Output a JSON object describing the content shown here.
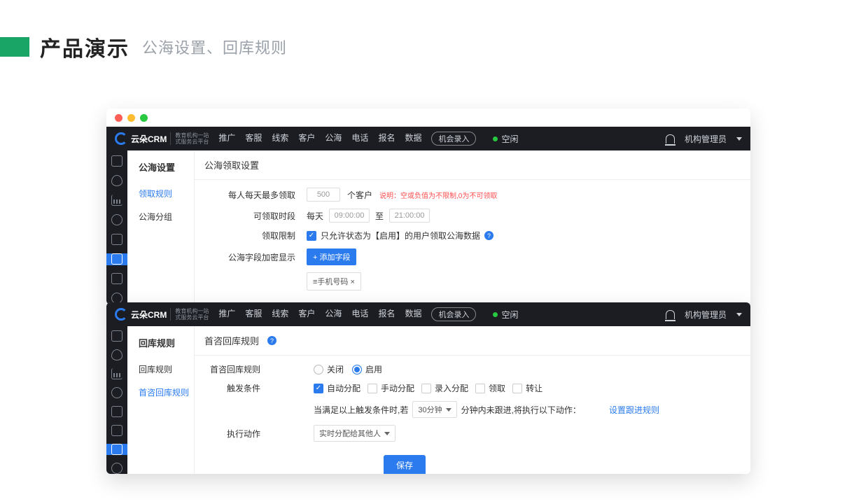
{
  "slide": {
    "title_main": "产品演示",
    "title_sub": "公海设置、回库规则"
  },
  "topnav": {
    "brand": "云朵CRM",
    "brand_sub1": "教育机构一站",
    "brand_sub2": "式服务云平台",
    "items": [
      "推广",
      "客服",
      "线索",
      "客户",
      "公海",
      "电话",
      "报名",
      "数据"
    ],
    "pill": "机会录入",
    "status": "空闲",
    "user": "机构管理员"
  },
  "win1": {
    "side_title": "公海设置",
    "side_items": [
      "领取规则",
      "公海分组"
    ],
    "active": 0,
    "section": "公海领取设置",
    "r1_lbl": "每人每天最多领取",
    "r1_val": "500",
    "r1_unit": "个客户",
    "r1_hint": "说明：空或负值为不限制,0为不可领取",
    "r2_lbl": "可领取时段",
    "r2_pre": "每天",
    "r2_from": "09:00:00",
    "r2_mid": "至",
    "r2_to": "21:00:00",
    "r3_lbl": "领取限制",
    "r3_text": "只允许状态为【启用】的用户领取公海数据",
    "r4_lbl": "公海字段加密显示",
    "r4_btn": "+ 添加字段",
    "r4_tag": "≡手机号码 ×"
  },
  "win2": {
    "side_title": "回库规则",
    "side_items": [
      "回库规则",
      "首咨回库规则"
    ],
    "active": 1,
    "section": "首咨回库规则",
    "r1_lbl": "首咨回库规则",
    "r1_off": "关闭",
    "r1_on": "启用",
    "r2_lbl": "触发条件",
    "r2_opts": [
      "自动分配",
      "手动分配",
      "录入分配",
      "领取",
      "转让"
    ],
    "r2_checked": [
      true,
      false,
      false,
      false,
      false
    ],
    "r3_pre": "当满足以上触发条件时,若",
    "r3_sel": "30分钟",
    "r3_mid": "分钟内未跟进,将执行以下动作：",
    "r3_link": "设置跟进规则",
    "r4_lbl": "执行动作",
    "r4_sel": "实时分配给其他人",
    "save": "保存"
  }
}
